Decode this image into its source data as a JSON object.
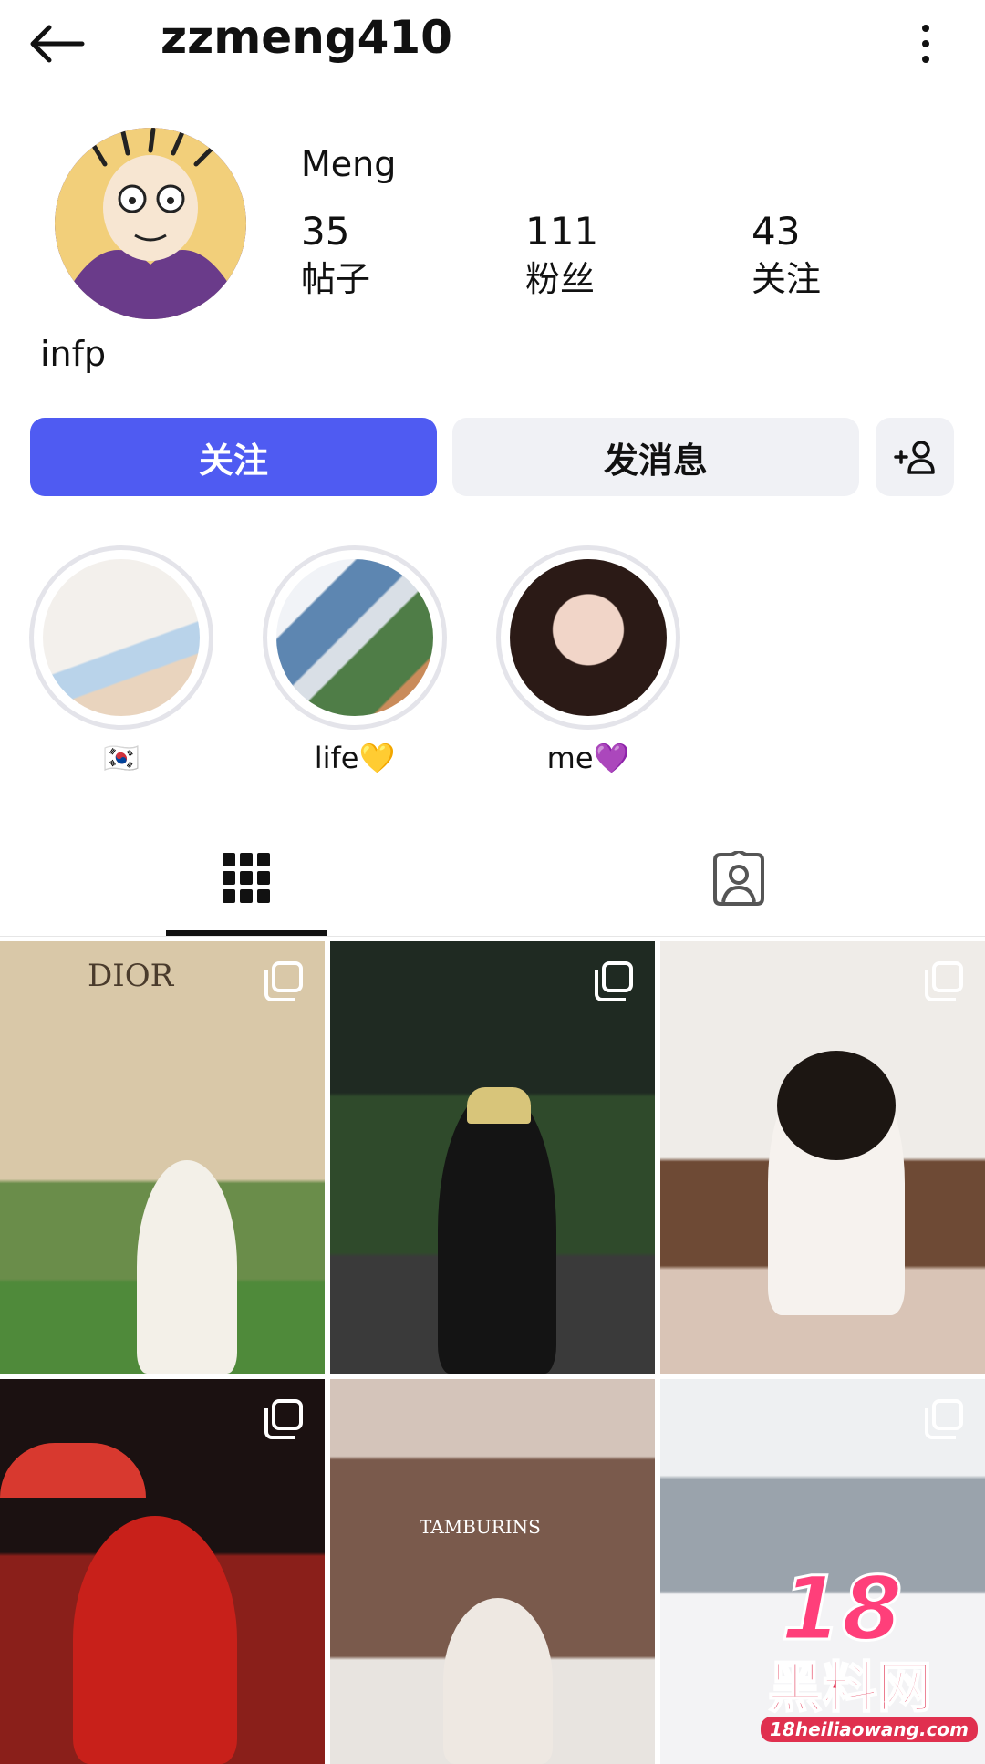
{
  "header": {
    "username": "zzmeng410"
  },
  "profile": {
    "display_name": "Meng",
    "bio": "infp",
    "stats": [
      {
        "value": "35",
        "label": "帖子"
      },
      {
        "value": "111",
        "label": "粉丝"
      },
      {
        "value": "43",
        "label": "关注"
      }
    ]
  },
  "actions": {
    "follow_label": "关注",
    "message_label": "发消息"
  },
  "highlights": [
    {
      "label": "🇰🇷"
    },
    {
      "label": "life💛"
    },
    {
      "label": "me💜"
    }
  ],
  "posts": [
    {
      "text": "DIOR",
      "multi": true
    },
    {
      "text": "",
      "multi": true
    },
    {
      "text": "",
      "multi": true
    },
    {
      "text": "",
      "multi": true
    },
    {
      "text": "TAMBURINS",
      "multi": false
    },
    {
      "text": "",
      "multi": true
    }
  ],
  "watermark": {
    "number": "18",
    "name": "黑料网",
    "url": "18heiliaowang.com"
  },
  "colors": {
    "accent": "#4f5bf2",
    "secondary_button": "#f0f1f5"
  }
}
